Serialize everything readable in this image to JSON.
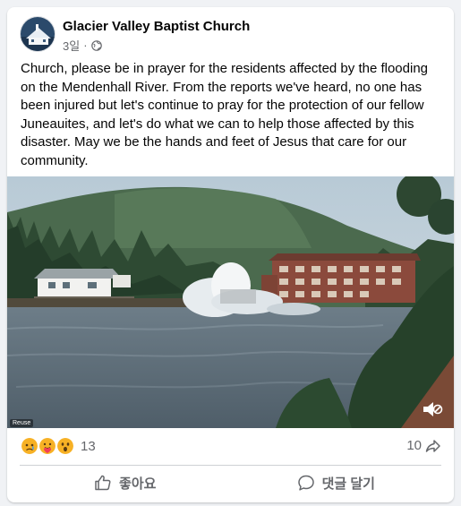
{
  "post": {
    "page_name": "Glacier Valley Baptist Church",
    "time": "3일",
    "separator": "·",
    "privacy_icon": "globe-icon",
    "text": "Church, please be in prayer for the residents affected by the flooding on the Mendenhall River. From the reports we've heard, no one has been injured but let's continue to pray for the protection of our fellow Juneauites, and let's do what we can to help those affected by this disaster. May we be the hands and feet of Jesus that care for our community.",
    "media": {
      "watermark": "Reuse",
      "volume_icon": "volume-muted-icon"
    }
  },
  "footer": {
    "reactions": [
      "sad-emoji",
      "care-emoji",
      "wow-emoji"
    ],
    "reaction_count": "13",
    "share_count": "10",
    "like_label": "좋아요",
    "comment_label": "댓글 달기"
  },
  "colors": {
    "background": "#f0f2f5",
    "card": "#ffffff",
    "secondary_text": "#65676b",
    "reaction_yellow": "#f7b125"
  }
}
